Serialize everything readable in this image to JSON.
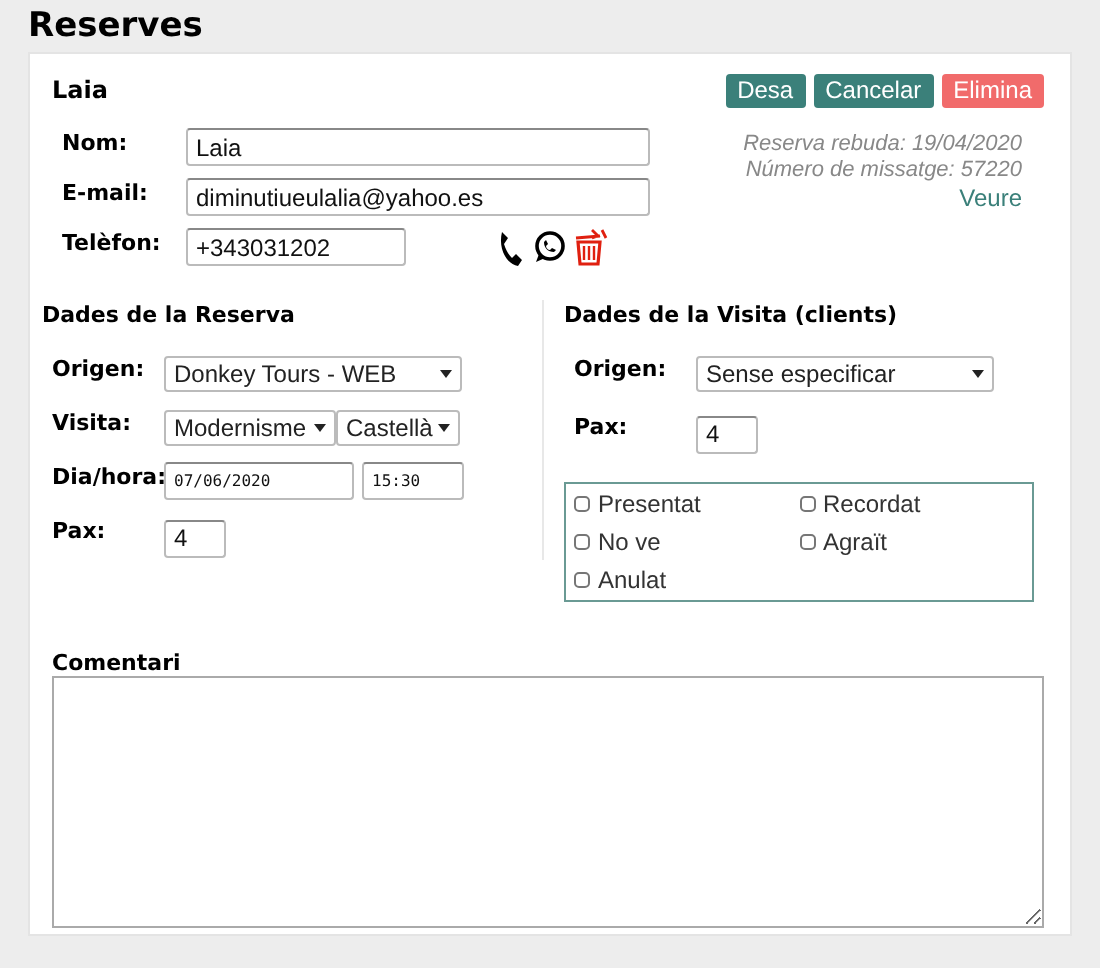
{
  "page_title": "Reserves",
  "card": {
    "name": "Laia",
    "buttons": [
      {
        "label": "Desa",
        "kind": "primary"
      },
      {
        "label": "Cancelar",
        "kind": "primary"
      },
      {
        "label": "Elimina",
        "kind": "danger"
      }
    ],
    "contact_fields": [
      {
        "label": "Nom:",
        "value": "Laia",
        "kind": "wide"
      },
      {
        "label": "E-mail:",
        "value": "diminutiueulalia@yahoo.es",
        "kind": "wide"
      },
      {
        "label": "Telèfon:",
        "value": "+343031202",
        "kind": "phone"
      }
    ],
    "info": {
      "received": "Reserva rebuda: 19/04/2020",
      "message_number": "Número de missatge: 57220",
      "link": "Veure"
    },
    "booking": {
      "title": "Dades de la Reserva",
      "rows": [
        {
          "label": "Origen:",
          "kind": "select",
          "value": "Donkey Tours - WEB"
        },
        {
          "label": "Visita:",
          "kind": "two_selects",
          "values": [
            "Modernisme",
            "Castellà"
          ]
        },
        {
          "label": "Dia/hora:",
          "kind": "datetime",
          "values": [
            "07/06/2020",
            "15:30"
          ]
        },
        {
          "label": "Pax:",
          "kind": "number",
          "value": "4"
        }
      ]
    },
    "visit": {
      "title": "Dades de la Visita (clients)",
      "rows": [
        {
          "label": "Origen:",
          "kind": "select",
          "value": "Sense especificar"
        },
        {
          "label": "Pax:",
          "kind": "number",
          "value": "4"
        }
      ],
      "checkboxes": [
        {
          "label": "Presentat",
          "checked": false
        },
        {
          "label": "Recordat",
          "checked": false
        },
        {
          "label": "No ve",
          "checked": false
        },
        {
          "label": "Agraït",
          "checked": false
        },
        {
          "label": "Anulat",
          "checked": false
        }
      ]
    },
    "comment": {
      "label": "Comentari"
    }
  }
}
